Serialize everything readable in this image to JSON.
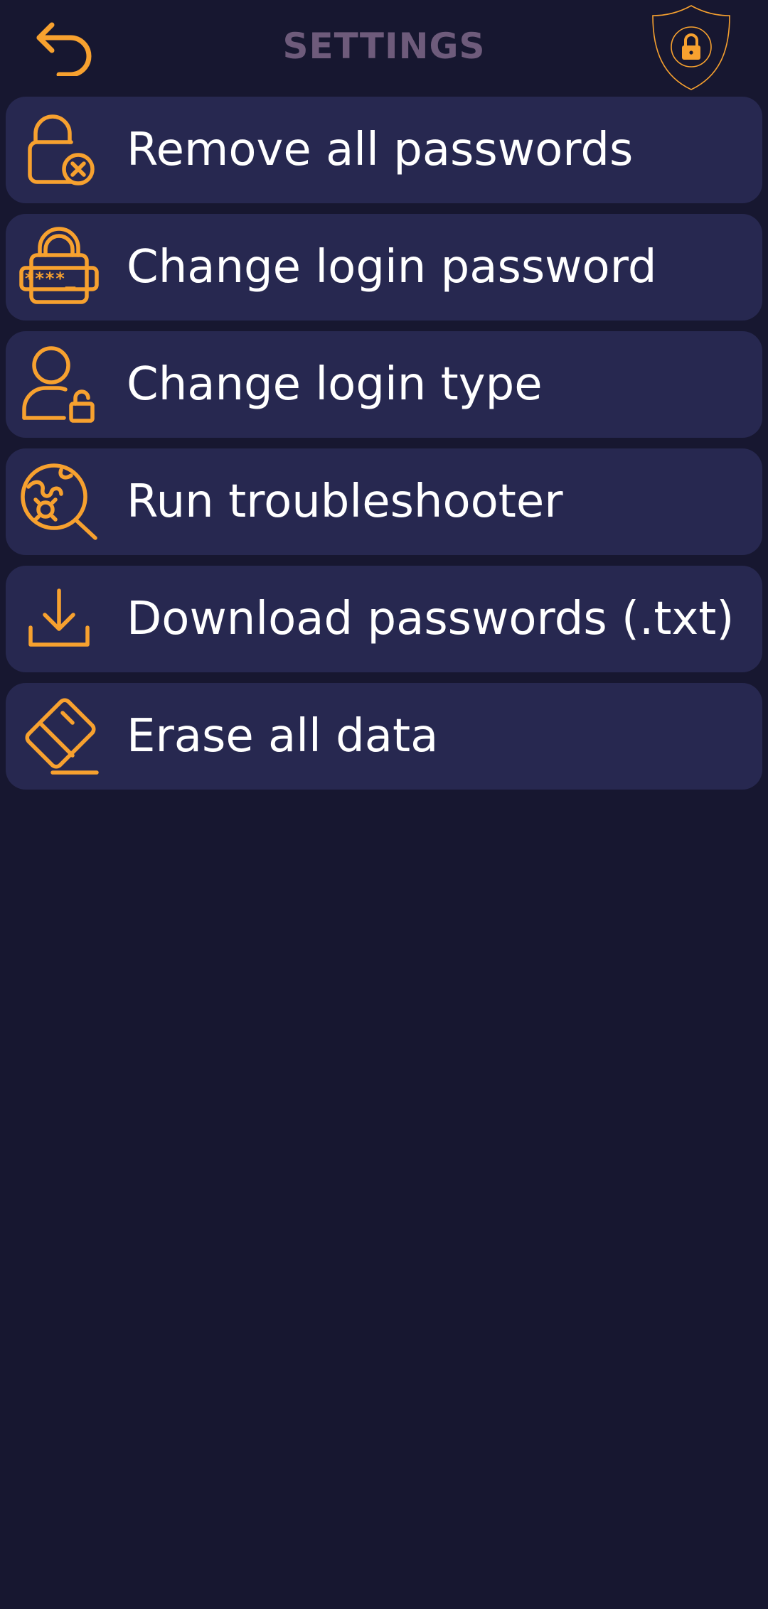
{
  "header": {
    "title": "SETTINGS",
    "back_icon": "back-arrow-icon",
    "badge_icon": "shield-lock-icon"
  },
  "colors": {
    "background": "#171730",
    "card": "#272850",
    "accent": "#f7a12f",
    "title": "#6e5b7b",
    "text": "#ffffff"
  },
  "menu": {
    "items": [
      {
        "label": "Remove all passwords",
        "icon": "lock-remove-icon"
      },
      {
        "label": "Change login password",
        "icon": "lock-password-icon"
      },
      {
        "label": "Change login type",
        "icon": "user-lock-icon"
      },
      {
        "label": "Run troubleshooter",
        "icon": "globe-search-icon"
      },
      {
        "label": "Download passwords (.txt)",
        "icon": "download-icon"
      },
      {
        "label": "Erase all data",
        "icon": "eraser-icon"
      }
    ]
  }
}
